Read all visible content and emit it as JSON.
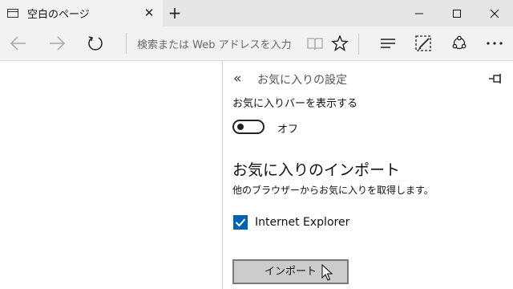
{
  "tab": {
    "title": "空白のページ",
    "icon": "page-icon"
  },
  "window_controls": [
    "minimize",
    "maximize",
    "close"
  ],
  "address_bar": {
    "placeholder": "検索または Web アドレスを入力"
  },
  "panel": {
    "title": "お気に入りの設定",
    "favorites_bar": {
      "label": "お気に入りバーを表示する",
      "toggle_state": "オフ"
    },
    "import": {
      "heading": "お気に入りのインポート",
      "description": "他のブラウザーからお気に入りを取得します。",
      "browsers": [
        {
          "name": "Internet Explorer",
          "checked": true
        }
      ],
      "button_label": "インポート"
    }
  },
  "colors": {
    "accent": "#0063b1",
    "button_bg": "#cccccc"
  }
}
